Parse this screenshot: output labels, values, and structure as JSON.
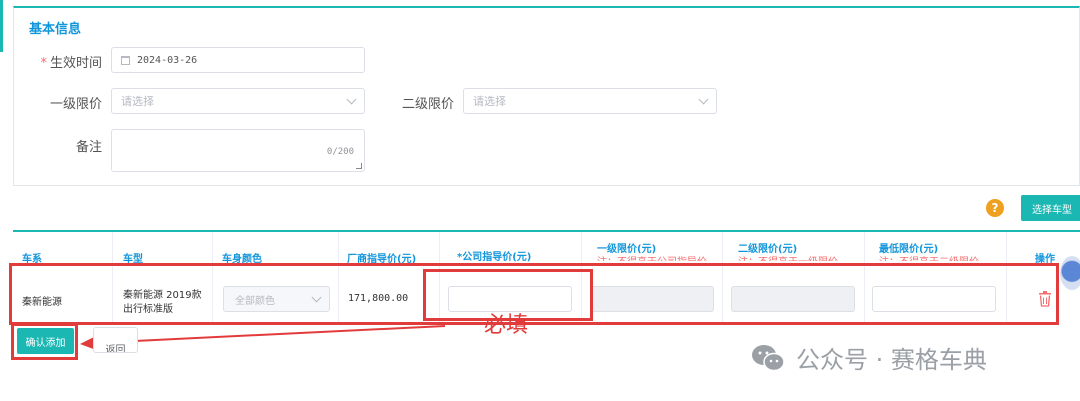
{
  "basic_info": {
    "title": "基本信息",
    "effective_time": {
      "label": "生效时间",
      "required_mark": "*",
      "value": "2024-03-26"
    },
    "level1_limit": {
      "label": "一级限价",
      "placeholder": "请选择"
    },
    "level2_limit": {
      "label": "二级限价",
      "placeholder": "请选择"
    },
    "remark": {
      "label": "备注",
      "counter": "0/200"
    }
  },
  "toolbar": {
    "help_icon_glyph": "?",
    "select_model_label": "选择车型"
  },
  "table": {
    "headers": {
      "series": "车系",
      "model": "车型",
      "color": "车身颜色",
      "factory_price": "厂商指导价(元)",
      "company_price": "*公司指导价(元)",
      "level1": "一级限价(元)",
      "level1_note": "注：不得高于公司指导价",
      "level2": "二级限价(元)",
      "level2_note": "注：不得高于一级限价",
      "min": "最低限价(元)",
      "min_note": "注：不得高于二级限价",
      "action": "操作"
    },
    "row": {
      "series": "秦新能源",
      "model_line1": "秦新能源 2019款",
      "model_line2": "出行标准版",
      "color_placeholder": "全部颜色",
      "factory_price": "171,800.00"
    }
  },
  "annotation": {
    "must_fill": "必填"
  },
  "buttons": {
    "confirm": "确认添加",
    "back": "返回"
  },
  "watermark": {
    "text": "公众号 · 赛格车典"
  },
  "colors": {
    "accent": "#1bb7b3",
    "title_blue": "#1296db",
    "annotation_red": "#e23b3b",
    "warning": "#f0a020"
  }
}
